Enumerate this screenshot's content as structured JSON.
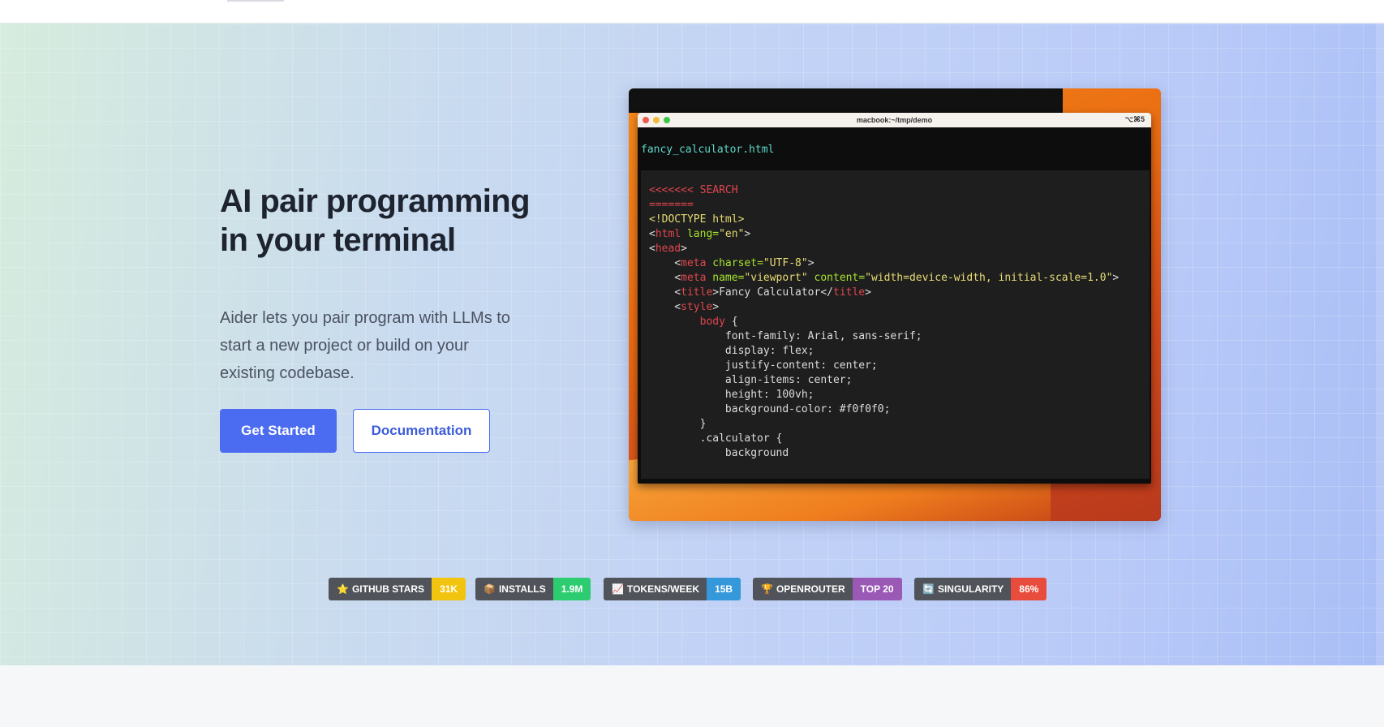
{
  "hero": {
    "headline_line1": "AI pair programming",
    "headline_line2": "in your terminal",
    "subtext": "Aider lets you pair program with LLMs to start a new project or build on your existing codebase.",
    "primary_button": "Get Started",
    "secondary_button": "Documentation"
  },
  "terminal": {
    "window_title": "macbook:~/tmp/demo",
    "shortcut": "⌥⌘5",
    "filename": "fancy_calculator.html",
    "code_lines": [
      {
        "segments": [
          {
            "t": "<<<<<<< SEARCH",
            "c": "c-red"
          }
        ]
      },
      {
        "segments": [
          {
            "t": "=======",
            "c": "c-red"
          }
        ]
      },
      {
        "segments": [
          {
            "t": "<!DOCTYPE html>",
            "c": "c-yellow"
          }
        ]
      },
      {
        "segments": [
          {
            "t": "<",
            "c": ""
          },
          {
            "t": "html",
            "c": "c-red"
          },
          {
            "t": " lang=",
            "c": "c-green"
          },
          {
            "t": "\"en\"",
            "c": "c-yellow"
          },
          {
            "t": ">",
            "c": ""
          }
        ]
      },
      {
        "segments": [
          {
            "t": "<",
            "c": ""
          },
          {
            "t": "head",
            "c": "c-red"
          },
          {
            "t": ">",
            "c": ""
          }
        ]
      },
      {
        "segments": [
          {
            "t": "    <",
            "c": ""
          },
          {
            "t": "meta",
            "c": "c-red"
          },
          {
            "t": " charset=",
            "c": "c-green"
          },
          {
            "t": "\"UTF-8\"",
            "c": "c-yellow"
          },
          {
            "t": ">",
            "c": ""
          }
        ]
      },
      {
        "segments": [
          {
            "t": "    <",
            "c": ""
          },
          {
            "t": "meta",
            "c": "c-red"
          },
          {
            "t": " name=",
            "c": "c-green"
          },
          {
            "t": "\"viewport\"",
            "c": "c-yellow"
          },
          {
            "t": " content=",
            "c": "c-green"
          },
          {
            "t": "\"width=device-width, initial-scale=1.0\"",
            "c": "c-yellow"
          },
          {
            "t": ">",
            "c": ""
          }
        ]
      },
      {
        "segments": [
          {
            "t": "    <",
            "c": ""
          },
          {
            "t": "title",
            "c": "c-red"
          },
          {
            "t": ">Fancy Calculator</",
            "c": ""
          },
          {
            "t": "title",
            "c": "c-red"
          },
          {
            "t": ">",
            "c": ""
          }
        ]
      },
      {
        "segments": [
          {
            "t": "    <",
            "c": ""
          },
          {
            "t": "style",
            "c": "c-red"
          },
          {
            "t": ">",
            "c": ""
          }
        ]
      },
      {
        "segments": [
          {
            "t": "        ",
            "c": ""
          },
          {
            "t": "body",
            "c": "c-red"
          },
          {
            "t": " {",
            "c": ""
          }
        ]
      },
      {
        "segments": [
          {
            "t": "            font-family: Arial, sans-serif;",
            "c": ""
          }
        ]
      },
      {
        "segments": [
          {
            "t": "            display: flex;",
            "c": ""
          }
        ]
      },
      {
        "segments": [
          {
            "t": "            justify-content: center;",
            "c": ""
          }
        ]
      },
      {
        "segments": [
          {
            "t": "            align-items: center;",
            "c": ""
          }
        ]
      },
      {
        "segments": [
          {
            "t": "            height: 100vh;",
            "c": ""
          }
        ]
      },
      {
        "segments": [
          {
            "t": "            background-color: #f0f0f0;",
            "c": ""
          }
        ]
      },
      {
        "segments": [
          {
            "t": "        }",
            "c": ""
          }
        ]
      },
      {
        "segments": [
          {
            "t": "        .calculator {",
            "c": ""
          }
        ]
      },
      {
        "segments": [
          {
            "t": "            background",
            "c": ""
          }
        ]
      }
    ]
  },
  "stats": [
    {
      "icon": "⭐",
      "icon_name": "star-icon",
      "label": "GITHUB STARS",
      "value": "31K",
      "color": "#f1c40f"
    },
    {
      "icon": "📦",
      "icon_name": "package-icon",
      "label": "INSTALLS",
      "value": "1.9M",
      "color": "#2ecc71"
    },
    {
      "icon": "📈",
      "icon_name": "chart-icon",
      "label": "TOKENS/WEEK",
      "value": "15B",
      "color": "#3498db"
    },
    {
      "icon": "🏆",
      "icon_name": "trophy-icon",
      "label": "OPENROUTER",
      "value": "TOP 20",
      "color": "#9b59b6"
    },
    {
      "icon": "🔄",
      "icon_name": "refresh-icon",
      "label": "SINGULARITY",
      "value": "86%",
      "color": "#e74c3c"
    }
  ]
}
